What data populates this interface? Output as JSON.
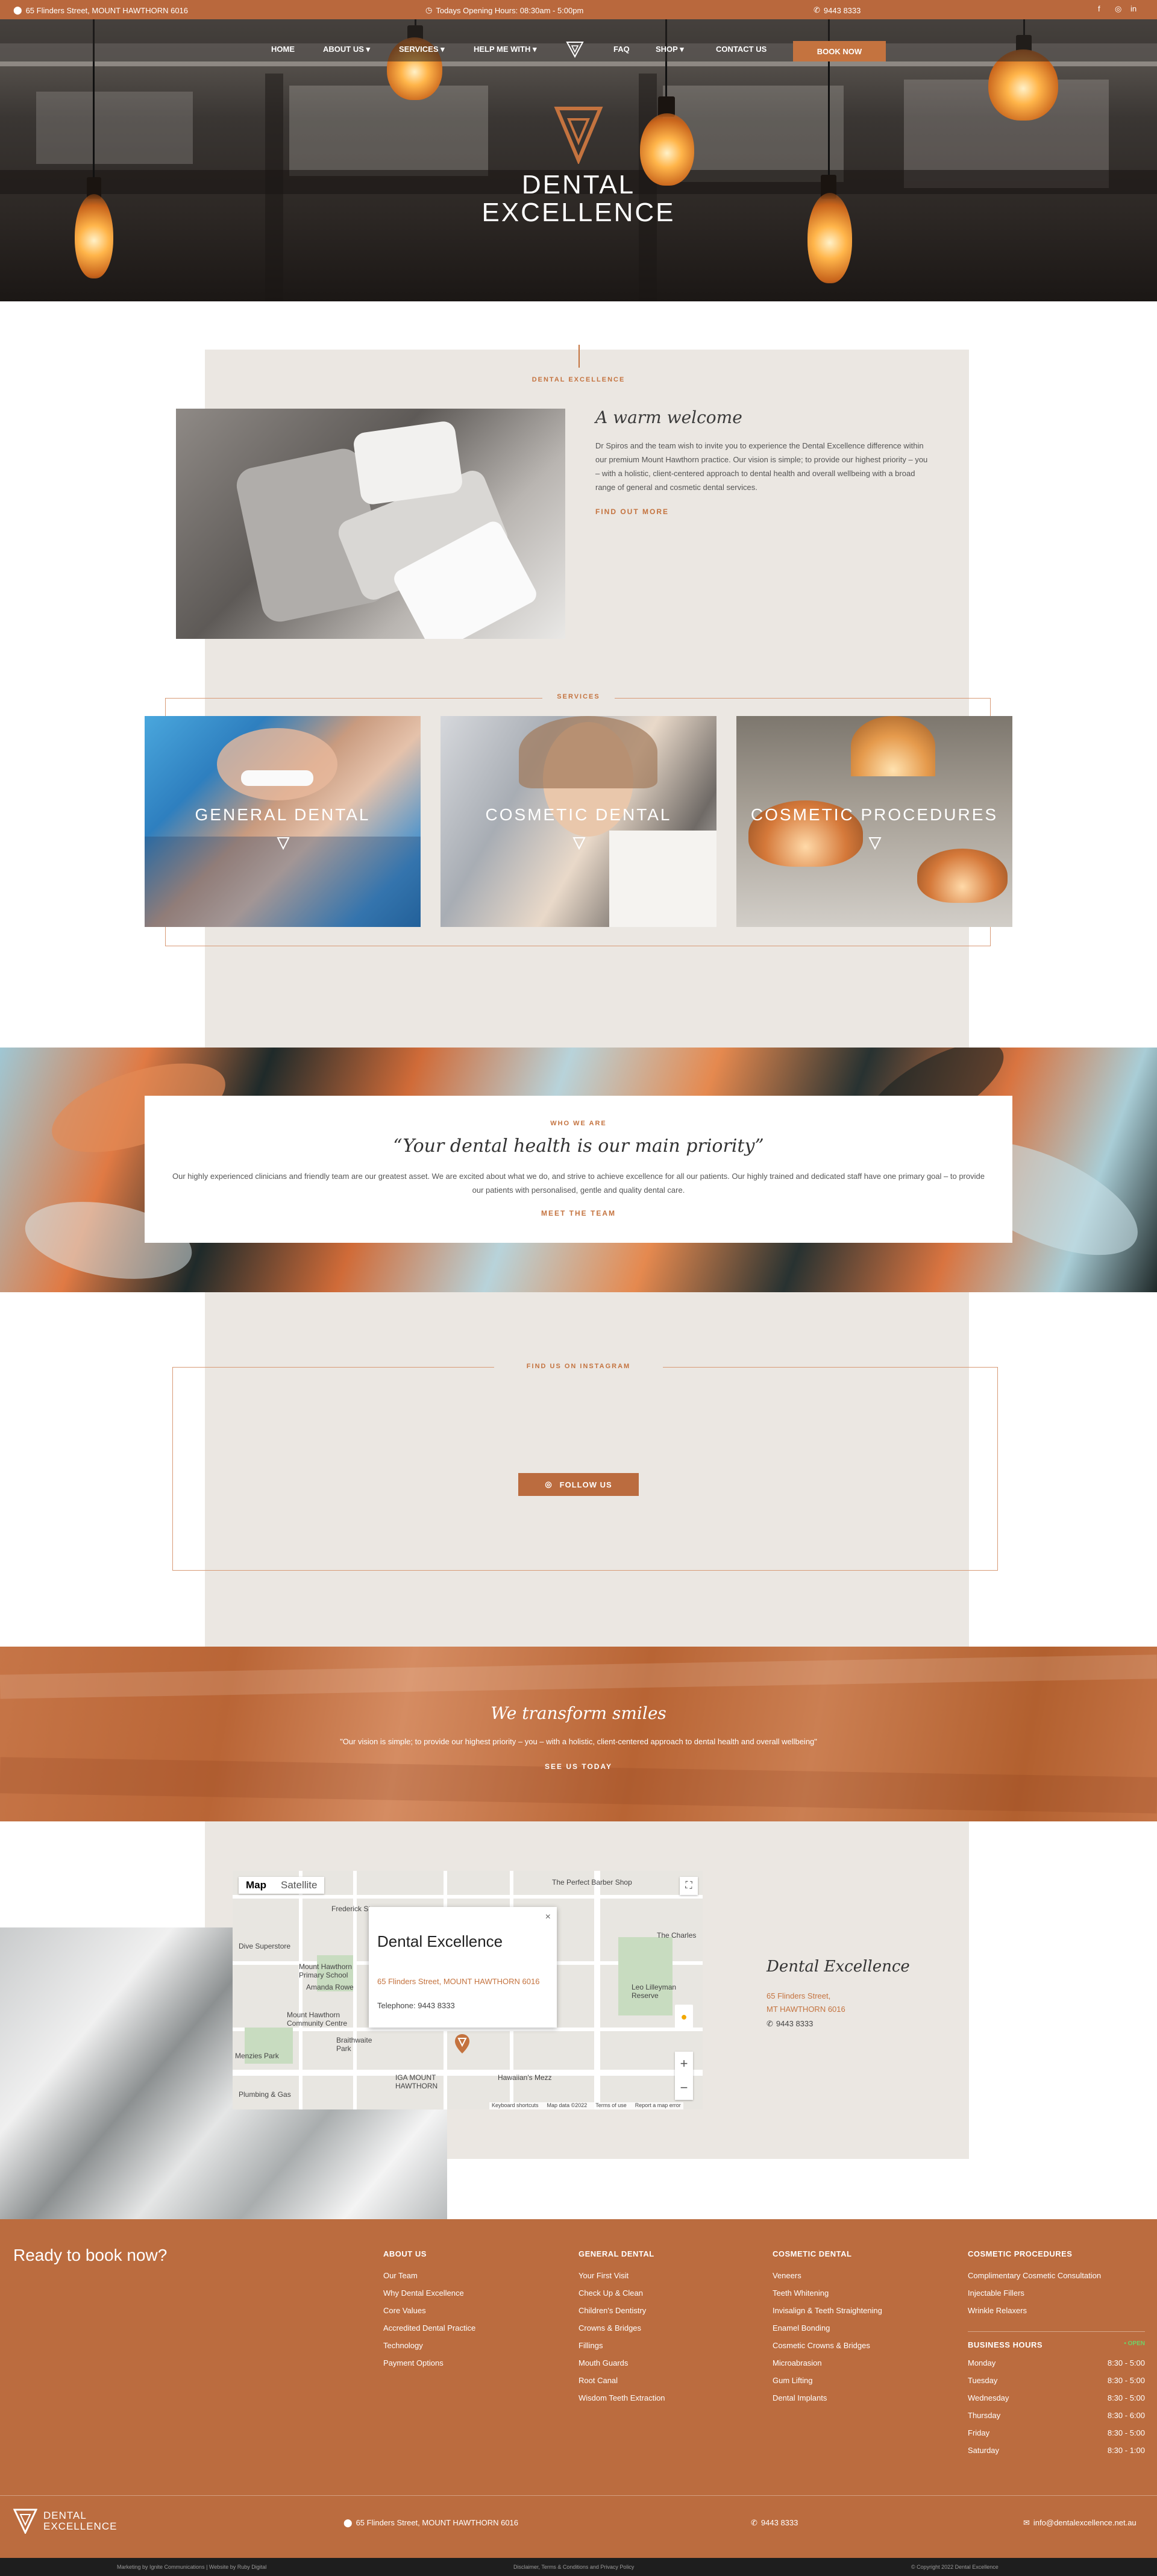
{
  "topbar": {
    "address": "65 Flinders Street, MOUNT HAWTHORN 6016",
    "hours": "Todays Opening Hours: 08:30am - 5:00pm",
    "phone": "9443 8333"
  },
  "nav": {
    "items": [
      "HOME",
      "ABOUT US",
      "SERVICES",
      "HELP ME WITH",
      "FAQ",
      "SHOP",
      "CONTACT US"
    ],
    "book": "BOOK NOW"
  },
  "brand": {
    "line1": "DENTAL",
    "line2": "EXCELLENCE"
  },
  "welcome": {
    "eyebrow": "DENTAL EXCELLENCE",
    "title": "A warm welcome",
    "body": "Dr Spiros and the team wish to invite you to experience the Dental Excellence difference within our premium Mount Hawthorn practice. Our vision is simple; to provide our highest priority – you – with a holistic, client-centered approach to dental health and overall wellbeing with a broad range of general and cosmetic dental services.",
    "cta": "FIND OUT MORE"
  },
  "services": {
    "eyebrow": "SERVICES",
    "cards": [
      "GENERAL DENTAL",
      "COSMETIC DENTAL",
      "COSMETIC PROCEDURES"
    ]
  },
  "who": {
    "eyebrow": "WHO WE ARE",
    "title": "“Your dental health is our main priority”",
    "body": "Our highly experienced clinicians and friendly team are our greatest asset. We are excited about what we do, and strive to achieve excellence for all our patients. Our highly trained and dedicated staff have one primary goal – to provide our patients with personalised, gentle and quality dental care.",
    "cta": "MEET THE TEAM"
  },
  "instagram": {
    "eyebrow": "FIND US ON INSTAGRAM",
    "button": "FOLLOW US"
  },
  "transform": {
    "title": "We transform smiles",
    "body": "\"Our vision is simple; to provide our highest priority – you – with a holistic, client-centered approach to dental health and overall wellbeing\"",
    "cta": "SEE US TODAY"
  },
  "map": {
    "tab_map": "Map",
    "tab_satellite": "Satellite",
    "popup_title": "Dental Excellence",
    "popup_address": "65 Flinders Street, MOUNT HAWTHORN 6016",
    "popup_phone": "Telephone: 9443 8333",
    "labels": [
      "Frederick St",
      "The Perfect Barber Shop",
      "Dive Superstore",
      "Mount Hawthorn Primary School",
      "Amanda Rowe",
      "Mount Hawthorn Community Centre",
      "Braithwaite Park",
      "Menzies Park",
      "IGA MOUNT HAWTHORN",
      "Hawaiian's Mezz",
      "Leo Lilleyman Reserve",
      "The Charles",
      "Plumbing & Gas"
    ],
    "footer_items": [
      "Keyboard shortcuts",
      "Map data ©2022",
      "Terms of use",
      "Report a map error"
    ]
  },
  "contact": {
    "title": "Dental Excellence",
    "address1": "65 Flinders Street,",
    "address2": "MT HAWTHORN 6016",
    "phone": "9443 8333"
  },
  "footer": {
    "ready": "Ready to book now?",
    "columns": [
      {
        "title": "ABOUT US",
        "items": [
          "Our Team",
          "Why Dental Excellence",
          "Core Values",
          "Accredited Dental Practice",
          "Technology",
          "Payment Options"
        ]
      },
      {
        "title": "GENERAL DENTAL",
        "items": [
          "Your First Visit",
          "Check Up & Clean",
          "Children's Dentistry",
          "Crowns & Bridges",
          "Fillings",
          "Mouth Guards",
          "Root Canal",
          "Wisdom Teeth Extraction"
        ]
      },
      {
        "title": "COSMETIC DENTAL",
        "items": [
          "Veneers",
          "Teeth Whitening",
          "Invisalign & Teeth Straightening",
          "Enamel Bonding",
          "Cosmetic Crowns & Bridges",
          "Microabrasion",
          "Gum Lifting",
          "Dental Implants"
        ]
      },
      {
        "title": "COSMETIC PROCEDURES",
        "items": [
          "Complimentary Cosmetic Consultation",
          "Injectable Fillers",
          "Wrinkle Relaxers"
        ]
      }
    ],
    "hours_title": "BUSINESS HOURS",
    "hours_status": "• OPEN",
    "hours": [
      {
        "day": "Monday",
        "time": "8:30 - 5:00"
      },
      {
        "day": "Tuesday",
        "time": "8:30 - 5:00"
      },
      {
        "day": "Wednesday",
        "time": "8:30 - 5:00"
      },
      {
        "day": "Thursday",
        "time": "8:30 - 6:00"
      },
      {
        "day": "Friday",
        "time": "8:30 - 5:00"
      },
      {
        "day": "Saturday",
        "time": "8:30 - 1:00"
      }
    ],
    "bottom_address": "65 Flinders Street, MOUNT HAWTHORN 6016",
    "bottom_phone": "9443 8333",
    "bottom_email": "info@dentalexcellence.net.au",
    "credits_left": "Marketing by Ignite Communications | Website by Ruby Digital",
    "credits_mid": "Disclaimer, Terms & Conditions and Privacy Policy",
    "credits_right": "© Copyright 2022 Dental Excellence"
  },
  "colors": {
    "brand": "#bb6c3f",
    "accent": "#c4733f",
    "beige": "#ebe7e2"
  }
}
